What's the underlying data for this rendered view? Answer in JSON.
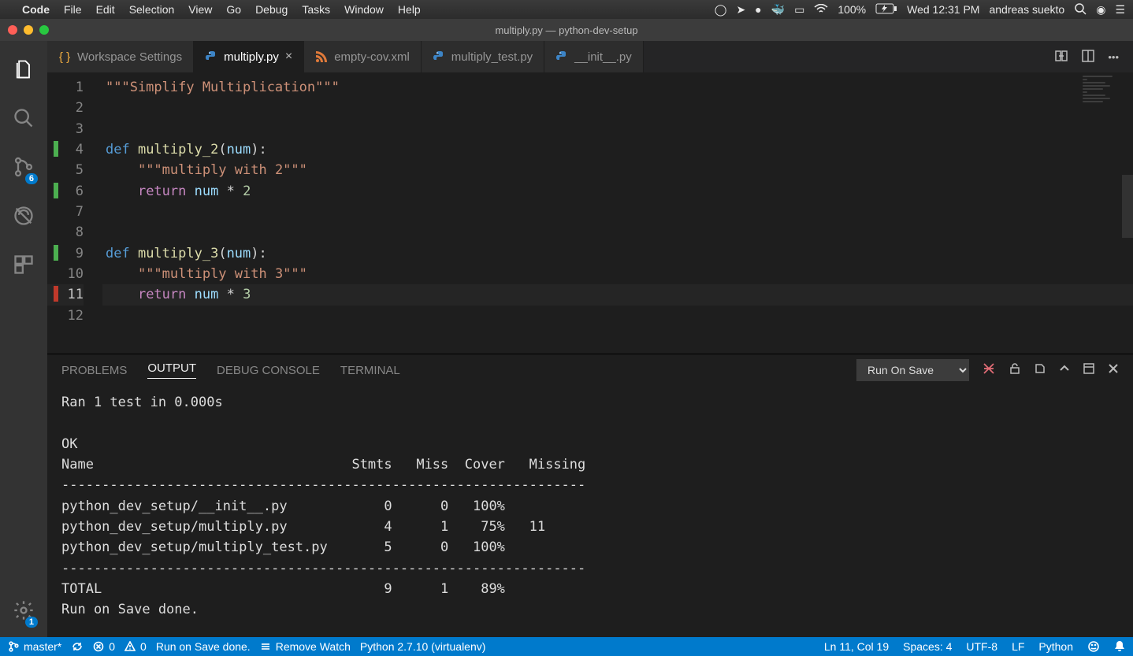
{
  "macos": {
    "app": "Code",
    "menus": [
      "File",
      "Edit",
      "Selection",
      "View",
      "Go",
      "Debug",
      "Tasks",
      "Window",
      "Help"
    ],
    "battery": "100%",
    "clock": "Wed 12:31 PM",
    "user": "andreas suekto"
  },
  "window": {
    "title": "multiply.py — python-dev-setup"
  },
  "activity": {
    "scm_badge": "6",
    "settings_badge": "1"
  },
  "tabs": [
    {
      "label": "Workspace Settings",
      "icon": "settings",
      "active": false,
      "closable": false
    },
    {
      "label": "multiply.py",
      "icon": "python",
      "active": true,
      "closable": true
    },
    {
      "label": "empty-cov.xml",
      "icon": "rss",
      "active": false,
      "closable": false
    },
    {
      "label": "multiply_test.py",
      "icon": "python",
      "active": false,
      "closable": false
    },
    {
      "label": "__init__.py",
      "icon": "python",
      "active": false,
      "closable": false
    }
  ],
  "editor": {
    "lines": [
      {
        "n": 1,
        "tokens": [
          [
            "\"\"\"Simplify Multiplication\"\"\"",
            "tok-str"
          ]
        ]
      },
      {
        "n": 2,
        "tokens": []
      },
      {
        "n": 3,
        "tokens": []
      },
      {
        "n": 4,
        "git": "add",
        "tokens": [
          [
            "def ",
            "tok-kw"
          ],
          [
            "multiply_2",
            "tok-fn"
          ],
          [
            "(",
            "tok-punc"
          ],
          [
            "num",
            "tok-param"
          ],
          [
            "):",
            "tok-punc"
          ]
        ]
      },
      {
        "n": 5,
        "indent": 1,
        "tokens": [
          [
            "\"\"\"multiply with 2\"\"\"",
            "tok-str"
          ]
        ]
      },
      {
        "n": 6,
        "git": "add",
        "indent": 1,
        "tokens": [
          [
            "return",
            "tok-kw2"
          ],
          [
            " ",
            "tok-op"
          ],
          [
            "num",
            "tok-param"
          ],
          [
            " * ",
            "tok-op"
          ],
          [
            "2",
            "tok-num"
          ]
        ]
      },
      {
        "n": 7,
        "tokens": []
      },
      {
        "n": 8,
        "tokens": []
      },
      {
        "n": 9,
        "git": "add",
        "tokens": [
          [
            "def ",
            "tok-kw"
          ],
          [
            "multiply_3",
            "tok-fn"
          ],
          [
            "(",
            "tok-punc"
          ],
          [
            "num",
            "tok-param"
          ],
          [
            "):",
            "tok-punc"
          ]
        ]
      },
      {
        "n": 10,
        "indent": 1,
        "tokens": [
          [
            "\"\"\"multiply with 3\"\"\"",
            "tok-str"
          ]
        ]
      },
      {
        "n": 11,
        "git": "del",
        "indent": 1,
        "hl": true,
        "tokens": [
          [
            "return",
            "tok-kw2"
          ],
          [
            " ",
            "tok-op"
          ],
          [
            "num",
            "tok-param"
          ],
          [
            " * ",
            "tok-op"
          ],
          [
            "3",
            "tok-num"
          ]
        ]
      },
      {
        "n": 12,
        "tokens": []
      }
    ]
  },
  "panel": {
    "tabs": [
      "PROBLEMS",
      "OUTPUT",
      "DEBUG CONSOLE",
      "TERMINAL"
    ],
    "active_tab": "OUTPUT",
    "channel": "Run On Save",
    "output": "Ran 1 test in 0.000s\n\nOK\nName                                Stmts   Miss  Cover   Missing\n-----------------------------------------------------------------\npython_dev_setup/__init__.py            0      0   100%\npython_dev_setup/multiply.py            4      1    75%   11\npython_dev_setup/multiply_test.py       5      0   100%\n-----------------------------------------------------------------\nTOTAL                                   9      1    89%\nRun on Save done."
  },
  "status": {
    "branch": "master*",
    "errors": "0",
    "warnings": "0",
    "message": "Run on Save done.",
    "action": "Remove Watch",
    "python": "Python 2.7.10 (virtualenv)",
    "ln_col": "Ln 11, Col 19",
    "spaces": "Spaces: 4",
    "encoding": "UTF-8",
    "eol": "LF",
    "language": "Python"
  }
}
